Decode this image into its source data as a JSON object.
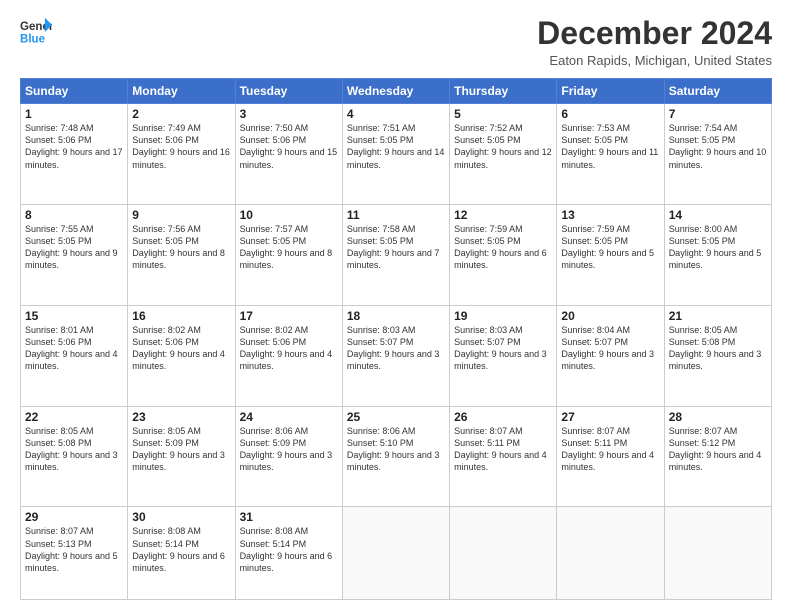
{
  "logo": {
    "line1": "General",
    "line2": "Blue"
  },
  "title": "December 2024",
  "location": "Eaton Rapids, Michigan, United States",
  "days_header": [
    "Sunday",
    "Monday",
    "Tuesday",
    "Wednesday",
    "Thursday",
    "Friday",
    "Saturday"
  ],
  "weeks": [
    [
      {
        "num": "1",
        "sunrise": "7:48 AM",
        "sunset": "5:06 PM",
        "daylight": "9 hours and 17 minutes."
      },
      {
        "num": "2",
        "sunrise": "7:49 AM",
        "sunset": "5:06 PM",
        "daylight": "9 hours and 16 minutes."
      },
      {
        "num": "3",
        "sunrise": "7:50 AM",
        "sunset": "5:06 PM",
        "daylight": "9 hours and 15 minutes."
      },
      {
        "num": "4",
        "sunrise": "7:51 AM",
        "sunset": "5:05 PM",
        "daylight": "9 hours and 14 minutes."
      },
      {
        "num": "5",
        "sunrise": "7:52 AM",
        "sunset": "5:05 PM",
        "daylight": "9 hours and 12 minutes."
      },
      {
        "num": "6",
        "sunrise": "7:53 AM",
        "sunset": "5:05 PM",
        "daylight": "9 hours and 11 minutes."
      },
      {
        "num": "7",
        "sunrise": "7:54 AM",
        "sunset": "5:05 PM",
        "daylight": "9 hours and 10 minutes."
      }
    ],
    [
      {
        "num": "8",
        "sunrise": "7:55 AM",
        "sunset": "5:05 PM",
        "daylight": "9 hours and 9 minutes."
      },
      {
        "num": "9",
        "sunrise": "7:56 AM",
        "sunset": "5:05 PM",
        "daylight": "9 hours and 8 minutes."
      },
      {
        "num": "10",
        "sunrise": "7:57 AM",
        "sunset": "5:05 PM",
        "daylight": "9 hours and 8 minutes."
      },
      {
        "num": "11",
        "sunrise": "7:58 AM",
        "sunset": "5:05 PM",
        "daylight": "9 hours and 7 minutes."
      },
      {
        "num": "12",
        "sunrise": "7:59 AM",
        "sunset": "5:05 PM",
        "daylight": "9 hours and 6 minutes."
      },
      {
        "num": "13",
        "sunrise": "7:59 AM",
        "sunset": "5:05 PM",
        "daylight": "9 hours and 5 minutes."
      },
      {
        "num": "14",
        "sunrise": "8:00 AM",
        "sunset": "5:05 PM",
        "daylight": "9 hours and 5 minutes."
      }
    ],
    [
      {
        "num": "15",
        "sunrise": "8:01 AM",
        "sunset": "5:06 PM",
        "daylight": "9 hours and 4 minutes."
      },
      {
        "num": "16",
        "sunrise": "8:02 AM",
        "sunset": "5:06 PM",
        "daylight": "9 hours and 4 minutes."
      },
      {
        "num": "17",
        "sunrise": "8:02 AM",
        "sunset": "5:06 PM",
        "daylight": "9 hours and 4 minutes."
      },
      {
        "num": "18",
        "sunrise": "8:03 AM",
        "sunset": "5:07 PM",
        "daylight": "9 hours and 3 minutes."
      },
      {
        "num": "19",
        "sunrise": "8:03 AM",
        "sunset": "5:07 PM",
        "daylight": "9 hours and 3 minutes."
      },
      {
        "num": "20",
        "sunrise": "8:04 AM",
        "sunset": "5:07 PM",
        "daylight": "9 hours and 3 minutes."
      },
      {
        "num": "21",
        "sunrise": "8:05 AM",
        "sunset": "5:08 PM",
        "daylight": "9 hours and 3 minutes."
      }
    ],
    [
      {
        "num": "22",
        "sunrise": "8:05 AM",
        "sunset": "5:08 PM",
        "daylight": "9 hours and 3 minutes."
      },
      {
        "num": "23",
        "sunrise": "8:05 AM",
        "sunset": "5:09 PM",
        "daylight": "9 hours and 3 minutes."
      },
      {
        "num": "24",
        "sunrise": "8:06 AM",
        "sunset": "5:09 PM",
        "daylight": "9 hours and 3 minutes."
      },
      {
        "num": "25",
        "sunrise": "8:06 AM",
        "sunset": "5:10 PM",
        "daylight": "9 hours and 3 minutes."
      },
      {
        "num": "26",
        "sunrise": "8:07 AM",
        "sunset": "5:11 PM",
        "daylight": "9 hours and 4 minutes."
      },
      {
        "num": "27",
        "sunrise": "8:07 AM",
        "sunset": "5:11 PM",
        "daylight": "9 hours and 4 minutes."
      },
      {
        "num": "28",
        "sunrise": "8:07 AM",
        "sunset": "5:12 PM",
        "daylight": "9 hours and 4 minutes."
      }
    ],
    [
      {
        "num": "29",
        "sunrise": "8:07 AM",
        "sunset": "5:13 PM",
        "daylight": "9 hours and 5 minutes."
      },
      {
        "num": "30",
        "sunrise": "8:08 AM",
        "sunset": "5:14 PM",
        "daylight": "9 hours and 6 minutes."
      },
      {
        "num": "31",
        "sunrise": "8:08 AM",
        "sunset": "5:14 PM",
        "daylight": "9 hours and 6 minutes."
      },
      null,
      null,
      null,
      null
    ]
  ]
}
